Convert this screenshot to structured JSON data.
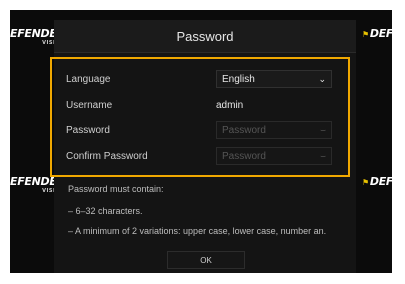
{
  "watermark": {
    "brand": "DEFENDER",
    "sub": "VISION",
    "brand_partial_left": "EFENDER",
    "brand_partial_right": "DEFEN"
  },
  "dialog": {
    "title": "Password",
    "fields": {
      "language": {
        "label": "Language",
        "value": "English"
      },
      "username": {
        "label": "Username",
        "value": "admin"
      },
      "password": {
        "label": "Password",
        "placeholder": "Password"
      },
      "confirm": {
        "label": "Confirm Password",
        "placeholder": "Password"
      }
    },
    "hints": {
      "intro": "Password must contain:",
      "rule1": "– 6–32 characters.",
      "rule2": "– A minimum of 2 variations: upper case, lower case, number an."
    },
    "ok_label": "OK"
  },
  "colors": {
    "accent_border": "#f0a800",
    "background": "#0b0b0b"
  },
  "icons": {
    "dropdown": "chevron-down-icon",
    "password_toggle": "eye-icon",
    "brand_flag": "flag-icon"
  }
}
